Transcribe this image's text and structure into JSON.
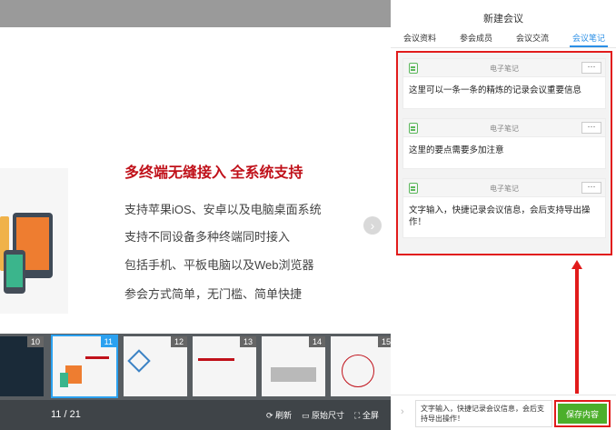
{
  "slide": {
    "title": "多终端无缝接入 全系统支持",
    "lines": [
      "支持苹果iOS、安卓以及电脑桌面系统",
      "支持不同设备多种终端同时接入",
      "包括手机、平板电脑以及Web浏览器",
      "参会方式简单，无门槛、简单快捷"
    ]
  },
  "thumbnails": [
    {
      "num": "10"
    },
    {
      "num": "11",
      "active": true
    },
    {
      "num": "12"
    },
    {
      "num": "13"
    },
    {
      "num": "14"
    },
    {
      "num": "15"
    }
  ],
  "bottom_bar": {
    "page_counter": "11 / 21",
    "refresh": "刷新",
    "original_size": "原始尺寸",
    "fullscreen": "全屏"
  },
  "panel": {
    "title": "新建会议",
    "tabs": [
      "会议资料",
      "参会成员",
      "会议交流",
      "会议笔记"
    ],
    "active_tab": 3
  },
  "notes": [
    {
      "label": "电子笔记",
      "more": "···",
      "text": "这里可以一条一条的精炼的记录会议重要信息"
    },
    {
      "label": "电子笔记",
      "more": "···",
      "text": "这里的要点需要多加注意"
    },
    {
      "label": "电子笔记",
      "more": "···",
      "text": "文字输入，快捷记录会议信息，会后支持导出操作！"
    }
  ],
  "input": {
    "value": "文字输入，快捷记录会议信息，会后支持导出操作！",
    "save_label": "保存内容"
  },
  "colors": {
    "accent_blue": "#2b8fe6",
    "highlight_red": "#e11b1b",
    "save_green": "#4caf2b",
    "slide_title_red": "#c0111a"
  }
}
